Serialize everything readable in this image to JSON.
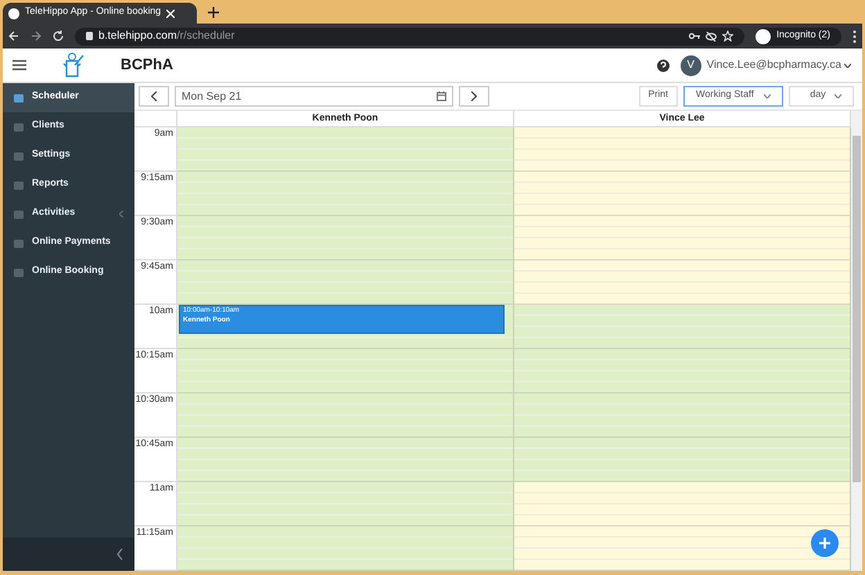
{
  "browser": {
    "tab_title": "TeleHippo App - Online booking",
    "url_host": "b.telehippo.com",
    "url_path": "/r/scheduler",
    "profile": "Incognito (2)"
  },
  "header": {
    "org": "BCPhA",
    "user_initial": "V",
    "user_email": "Vince.Lee@bcpharmacy.ca"
  },
  "sidebar": {
    "items": [
      {
        "label": "Scheduler",
        "selected": true,
        "kind": "link"
      },
      {
        "label": "Clients",
        "selected": false,
        "kind": "link"
      },
      {
        "label": "Settings",
        "selected": false,
        "kind": "link"
      },
      {
        "label": "Reports",
        "selected": false,
        "kind": "link"
      },
      {
        "label": "Activities",
        "selected": false,
        "kind": "submenu"
      },
      {
        "label": "Online Payments",
        "selected": false,
        "kind": "link"
      },
      {
        "label": "Online Booking",
        "selected": false,
        "kind": "link"
      }
    ]
  },
  "toolbar": {
    "date": "Mon Sep 21",
    "print": "Print",
    "staff_filter": "Working Staff",
    "view": "day"
  },
  "times": [
    "9am",
    "9:15am",
    "9:30am",
    "9:45am",
    "10am",
    "10:15am",
    "10:30am",
    "10:45am",
    "11am",
    "11:15am"
  ],
  "columns": [
    {
      "name": "Kenneth Poon",
      "slots": [
        {
          "working": true
        },
        {
          "working": true
        },
        {
          "working": true
        },
        {
          "working": true
        },
        {
          "working": true,
          "event": {
            "time": "10:00am-10:10am",
            "title": "Kenneth Poon"
          }
        },
        {
          "working": true
        },
        {
          "working": true
        },
        {
          "working": true
        },
        {
          "working": true
        },
        {
          "working": true
        }
      ]
    },
    {
      "name": "Vince Lee",
      "slots": [
        {
          "working": false
        },
        {
          "working": false
        },
        {
          "working": false
        },
        {
          "working": false
        },
        {
          "working": true
        },
        {
          "working": true
        },
        {
          "working": true
        },
        {
          "working": true
        },
        {
          "working": false
        },
        {
          "working": false
        }
      ]
    }
  ]
}
